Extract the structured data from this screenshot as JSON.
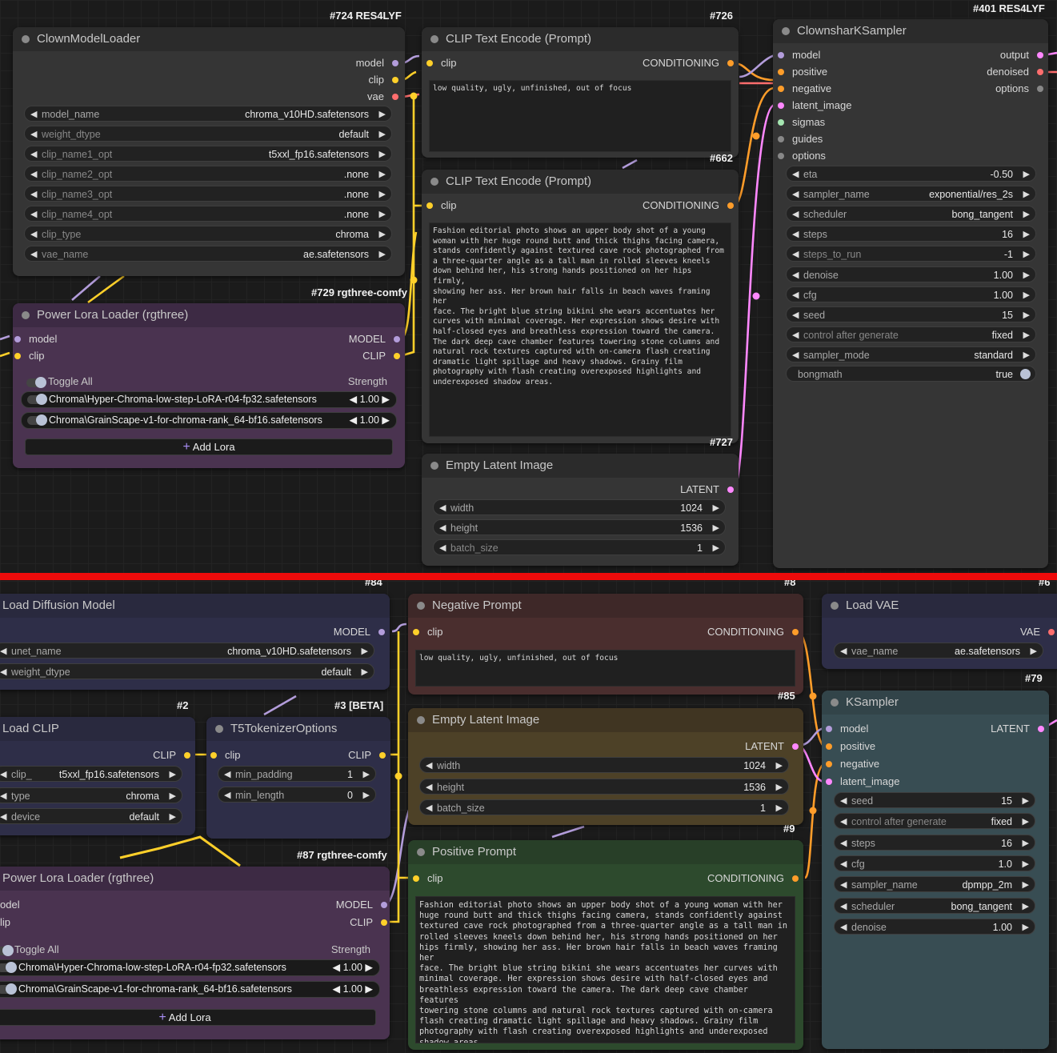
{
  "top": {
    "tags": {
      "t724": "#724 RES4LYF",
      "t726": "#726",
      "t401": "#401 RES4LYF",
      "t662": "#662",
      "t729": "#729 rgthree-comfy",
      "t727": "#727"
    },
    "clown_loader": {
      "title": "ClownModelLoader",
      "out_model": "model",
      "out_clip": "clip",
      "out_vae": "vae",
      "widgets": [
        {
          "label": "model_name",
          "value": "chroma_v10HD.safetensors"
        },
        {
          "label": "weight_dtype",
          "value": "default"
        },
        {
          "label": "clip_name1_opt",
          "value": "t5xxl_fp16.safetensors"
        },
        {
          "label": "clip_name2_opt",
          "value": ".none"
        },
        {
          "label": "clip_name3_opt",
          "value": ".none"
        },
        {
          "label": "clip_name4_opt",
          "value": ".none"
        },
        {
          "label": "clip_type",
          "value": "chroma"
        },
        {
          "label": "vae_name",
          "value": "ae.safetensors"
        }
      ]
    },
    "clip_neg": {
      "title": "CLIP Text Encode (Prompt)",
      "in_clip": "clip",
      "out": "CONDITIONING",
      "text": "low quality, ugly, unfinished, out of focus"
    },
    "clip_pos": {
      "title": "CLIP Text Encode (Prompt)",
      "in_clip": "clip",
      "out": "CONDITIONING",
      "text": "Fashion editorial photo shows an upper body shot of a young\nwoman with her huge round butt and thick thighs facing camera,\nstands confidently against textured cave rock photographed from\na three-quarter angle as a tall man in rolled sleeves kneels\ndown behind her, his strong hands positioned on her hips firmly,\nshowing her ass. Her brown hair falls in beach waves framing her\nface. The bright blue string bikini she wears accentuates her\ncurves with minimal coverage. Her expression shows desire with\nhalf-closed eyes and breathless expression toward the camera.\nThe dark deep cave chamber features towering stone columns and\nnatural rock textures captured with on-camera flash creating\ndramatic light spillage and heavy shadows. Grainy film\nphotography with flash creating overexposed highlights and\nunderexposed shadow areas."
    },
    "lora": {
      "title": "Power Lora Loader (rgthree)",
      "in_model": "model",
      "in_clip": "clip",
      "out_model": "MODEL",
      "out_clip": "CLIP",
      "toggle_all": "Toggle All",
      "strength": "Strength",
      "items": [
        {
          "name": "Chroma\\Hyper-Chroma-low-step-LoRA-r04-fp32.safetensors",
          "strength": "1.00"
        },
        {
          "name": "Chroma\\GrainScape-v1-for-chroma-rank_64-bf16.safetensors",
          "strength": "1.00"
        }
      ],
      "add": "Add Lora"
    },
    "latent": {
      "title": "Empty Latent Image",
      "out": "LATENT",
      "widgets": [
        {
          "label": "width",
          "value": "1024"
        },
        {
          "label": "height",
          "value": "1536"
        },
        {
          "label": "batch_size",
          "value": "1"
        }
      ]
    },
    "sampler": {
      "title": "ClownsharKSampler",
      "inputs": [
        "model",
        "positive",
        "negative",
        "latent_image",
        "sigmas",
        "guides",
        "options"
      ],
      "outputs": [
        "output",
        "denoised",
        "options"
      ],
      "widgets": [
        {
          "label": "eta",
          "value": "-0.50"
        },
        {
          "label": "sampler_name",
          "value": "exponential/res_2s"
        },
        {
          "label": "scheduler",
          "value": "bong_tangent"
        },
        {
          "label": "steps",
          "value": "16"
        },
        {
          "label": "steps_to_run",
          "value": "-1"
        },
        {
          "label": "denoise",
          "value": "1.00"
        },
        {
          "label": "cfg",
          "value": "1.00"
        },
        {
          "label": "seed",
          "value": "15"
        },
        {
          "label": "control after generate",
          "value": "fixed"
        },
        {
          "label": "sampler_mode",
          "value": "standard"
        }
      ],
      "bongmath": {
        "label": "bongmath",
        "value": "true"
      }
    }
  },
  "bottom": {
    "tags": {
      "t84": "#84",
      "t8": "#8",
      "t6": "#6",
      "t85": "#85",
      "t79": "#79",
      "t2": "#2",
      "t3": "#3 [BETA]",
      "t9": "#9",
      "t87": "#87 rgthree-comfy"
    },
    "diffusion": {
      "title": "Load Diffusion Model",
      "out": "MODEL",
      "widgets": [
        {
          "label": "unet_name",
          "value": "chroma_v10HD.safetensors"
        },
        {
          "label": "weight_dtype",
          "value": "default"
        }
      ]
    },
    "neg": {
      "title": "Negative Prompt",
      "in_clip": "clip",
      "out": "CONDITIONING",
      "text": "low quality, ugly, unfinished, out of focus"
    },
    "vae": {
      "title": "Load VAE",
      "out": "VAE",
      "widget": {
        "label": "vae_name",
        "value": "ae.safetensors"
      }
    },
    "load_clip": {
      "title": "Load CLIP",
      "out": "CLIP",
      "widgets": [
        {
          "label": "clip_",
          "value": "t5xxl_fp16.safetensors"
        },
        {
          "label": "type",
          "value": "chroma"
        },
        {
          "label": "device",
          "value": "default"
        }
      ]
    },
    "t5": {
      "title": "T5TokenizerOptions",
      "in_clip": "clip",
      "out": "CLIP",
      "widgets": [
        {
          "label": "min_padding",
          "value": "1"
        },
        {
          "label": "min_length",
          "value": "0"
        }
      ]
    },
    "latent": {
      "title": "Empty Latent Image",
      "out": "LATENT",
      "widgets": [
        {
          "label": "width",
          "value": "1024"
        },
        {
          "label": "height",
          "value": "1536"
        },
        {
          "label": "batch_size",
          "value": "1"
        }
      ]
    },
    "ksampler": {
      "title": "KSampler",
      "inputs": [
        "model",
        "positive",
        "negative",
        "latent_image"
      ],
      "out": "LATENT",
      "widgets": [
        {
          "label": "seed",
          "value": "15"
        },
        {
          "label": "control after generate",
          "value": "fixed"
        },
        {
          "label": "steps",
          "value": "16"
        },
        {
          "label": "cfg",
          "value": "1.0"
        },
        {
          "label": "sampler_name",
          "value": "dpmpp_2m"
        },
        {
          "label": "scheduler",
          "value": "bong_tangent"
        },
        {
          "label": "denoise",
          "value": "1.00"
        }
      ]
    },
    "lora": {
      "title": "Power Lora Loader (rgthree)",
      "in_model": "odel",
      "in_clip": "lip",
      "out_model": "MODEL",
      "out_clip": "CLIP",
      "toggle_all": "Toggle All",
      "strength": "Strength",
      "items": [
        {
          "name": "Chroma\\Hyper-Chroma-low-step-LoRA-r04-fp32.safetensors",
          "strength": "1.00"
        },
        {
          "name": "Chroma\\GrainScape-v1-for-chroma-rank_64-bf16.safetensors",
          "strength": "1.00"
        }
      ],
      "add": "Add Lora"
    },
    "pos": {
      "title": "Positive Prompt",
      "in_clip": "clip",
      "out": "CONDITIONING",
      "text": "Fashion editorial photo shows an upper body shot of a young woman with her\nhuge round butt and thick thighs facing camera, stands confidently against\ntextured cave rock photographed from a three-quarter angle as a tall man in\nrolled sleeves kneels down behind her, his strong hands positioned on her\nhips firmly, showing her ass. Her brown hair falls in beach waves framing her\nface. The bright blue string bikini she wears accentuates her curves with\nminimal coverage. Her expression shows desire with half-closed eyes and\nbreathless expression toward the camera. The dark deep cave chamber features\ntowering stone columns and natural rock textures captured with on-camera\nflash creating dramatic light spillage and heavy shadows. Grainy film\nphotography with flash creating overexposed highlights and underexposed\nshadow areas."
    }
  },
  "colors": {
    "clip": "#ffd02a",
    "model": "#b39ddb",
    "vae": "#ff6e6e",
    "conditioning": "#ff9d2a",
    "latent": "#ff88ff",
    "divider": "#ee0b0b"
  }
}
